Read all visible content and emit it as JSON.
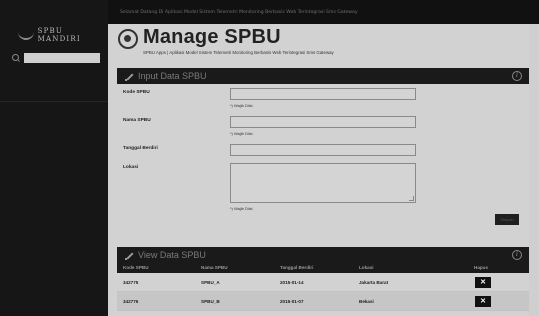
{
  "sidebar": {
    "brand": "SPBU MANDIRI",
    "search": {
      "value": "",
      "placeholder": ""
    }
  },
  "topbar": {
    "text": "Selamat Datang Di Aplikasi Model Sistem Telemetri Monitoring Berbasis Web Terintegrasi Sms Gateway"
  },
  "header": {
    "title": "Manage SPBU",
    "subtitle": "SPBU Apps | Aplikasi Model Sistem Telemetri Monitoring Berbasis Web Terintegrasi Sms Gateway"
  },
  "input_panel": {
    "title": "Input Data SPBU",
    "fields": [
      {
        "label": "Kode SPBU",
        "value": "",
        "help": "*) Wajib Diisi"
      },
      {
        "label": "Nama SPBU",
        "value": "",
        "help": "*) Wajib Diisi"
      },
      {
        "label": "Tanggal Berdiri",
        "value": ""
      },
      {
        "label": "Lokasi",
        "value": "",
        "help": "*) Wajib Diisi"
      }
    ],
    "submit_label": "Simpan"
  },
  "view_panel": {
    "title": "View Data SPBU",
    "columns": [
      "Kode SPBU",
      "Nama SPBU",
      "Tanggal Berdiri",
      "Lokasi",
      "Hapus"
    ],
    "rows": [
      {
        "kode": "342775",
        "nama": "SPBU_A",
        "tanggal": "2015-01-14",
        "lokasi": "Jakarta Barat",
        "action": "✕"
      },
      {
        "kode": "342776",
        "nama": "SPBU_B",
        "tanggal": "2015-01-07",
        "lokasi": "Bekasi",
        "action": "✕"
      }
    ]
  },
  "icons": {
    "brand": "gas-logo-icon",
    "search": "search-icon",
    "header": "disc-icon",
    "panel": "pencil-icon",
    "info": "info-icon",
    "delete": "close-icon"
  }
}
